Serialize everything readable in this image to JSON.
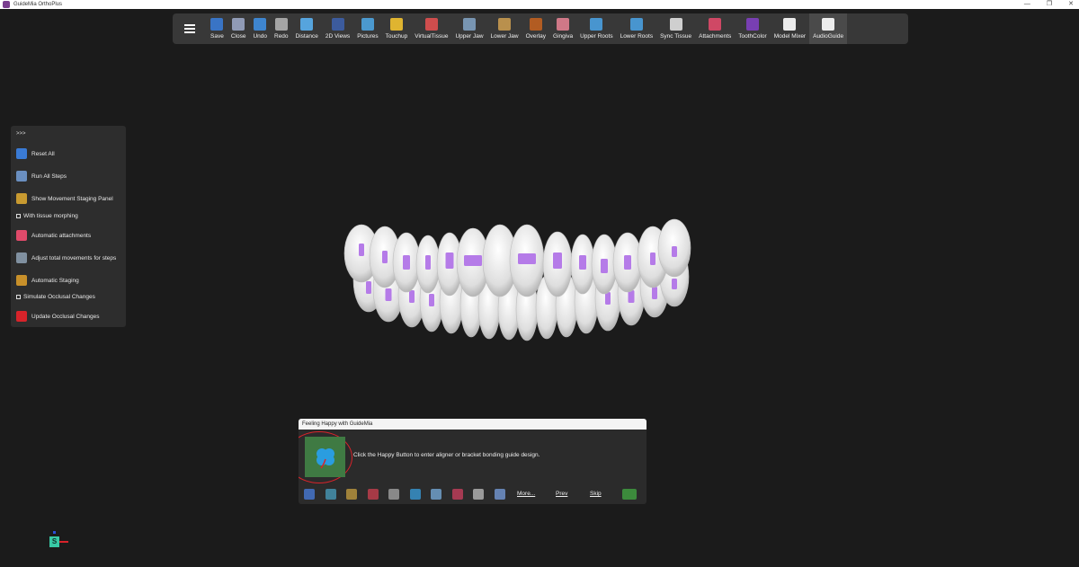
{
  "window": {
    "title": "GuideMia OrthoPlus",
    "controls": [
      "—",
      "❐",
      "✕"
    ]
  },
  "toolbar": {
    "items": [
      {
        "label": "Save",
        "icon": "save-icon",
        "color": "#3a7bd5"
      },
      {
        "label": "Close",
        "icon": "close-file-icon",
        "color": "#9aa6c4"
      },
      {
        "label": "Undo",
        "icon": "undo-icon",
        "color": "#3f8ee0"
      },
      {
        "label": "Redo",
        "icon": "redo-icon",
        "color": "#b0b0b0"
      },
      {
        "label": "Distance",
        "icon": "ruler-icon",
        "color": "#5ab0f0"
      },
      {
        "label": "2D Views",
        "icon": "2d-views-icon",
        "color": "#3d5fa8"
      },
      {
        "label": "Pictures",
        "icon": "pictures-icon",
        "color": "#4ea4e0"
      },
      {
        "label": "Touchup",
        "icon": "touchup-icon",
        "color": "#f2c230"
      },
      {
        "label": "VirtualTissue",
        "icon": "virtual-tissue-icon",
        "color": "#e05050"
      },
      {
        "label": "Upper Jaw",
        "icon": "upper-jaw-icon",
        "color": "#7fa0c0"
      },
      {
        "label": "Lower Jaw",
        "icon": "lower-jaw-icon",
        "color": "#c89a50"
      },
      {
        "label": "Overlay",
        "icon": "overlay-icon",
        "color": "#c06020"
      },
      {
        "label": "Gingiva",
        "icon": "gingiva-icon",
        "color": "#e08090"
      },
      {
        "label": "Upper Roots",
        "icon": "upper-roots-icon",
        "color": "#4aa0e0"
      },
      {
        "label": "Lower Roots",
        "icon": "lower-roots-icon",
        "color": "#4aa0e0"
      },
      {
        "label": "Sync Tissue",
        "icon": "sync-tissue-icon",
        "color": "#e0e0e0"
      },
      {
        "label": "Attachments",
        "icon": "attachments-icon",
        "color": "#e04a6a"
      },
      {
        "label": "ToothColor",
        "icon": "tooth-color-icon",
        "color": "#8040c0"
      },
      {
        "label": "Model Mixer",
        "icon": "cube-icon",
        "color": "#ffffff"
      },
      {
        "label": "AudioGuide",
        "icon": "mic-off-icon",
        "color": "#ffffff"
      }
    ]
  },
  "left_panel": {
    "toggle": ">>>",
    "items": [
      {
        "label": "Reset All",
        "icon": "reset-icon",
        "type": "button"
      },
      {
        "label": "Run All Steps",
        "icon": "run-steps-icon",
        "type": "button"
      },
      {
        "label": "Show Movement Staging Panel",
        "icon": "staging-panel-icon",
        "type": "button"
      },
      {
        "label": "With tissue morphing",
        "type": "checkbox"
      },
      {
        "label": "Automatic attachments",
        "icon": "auto-attachments-icon",
        "type": "button"
      },
      {
        "label": "Adjust total movements for steps",
        "icon": "adjust-movements-icon",
        "type": "button"
      },
      {
        "label": "Automatic Staging",
        "icon": "auto-staging-icon",
        "type": "button"
      },
      {
        "label": "Simulate Occlusal Changes",
        "type": "checkbox"
      },
      {
        "label": "Update Occlusal Changes",
        "icon": "update-occlusal-icon",
        "type": "button"
      }
    ]
  },
  "dialog": {
    "title": "Feeling Happy with GuideMia",
    "message": "Click the Happy Button to enter aligner or bracket bonding guide design.",
    "happy_icon": "clover-icon",
    "footer_icons": [
      "menu-icon",
      "panel-icon",
      "tools-icon",
      "arch-icon",
      "tooth-icon",
      "rotate-icon",
      "screen-icon",
      "attachment-icon",
      "bank-icon",
      "models-icon"
    ],
    "more": "More...",
    "prev": "Prev",
    "skip": "Skip",
    "next_icon": "next-robot-icon"
  },
  "gizmo": {
    "label": "S"
  }
}
